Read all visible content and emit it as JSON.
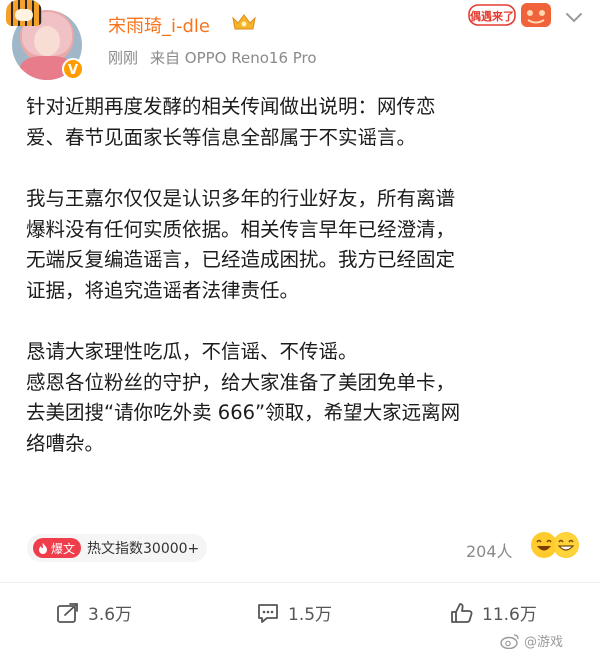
{
  "post": {
    "username": "宋雨琦_i-dle",
    "time": "刚刚",
    "source": "来自 OPPO Reno16 Pro",
    "paragraphs": [
      "针对近期再度发酵的相关传闻做出说明：网传恋\n爱、春节见面家长等信息全部属于不实谣言。",
      "我与王嘉尔仅仅是认识多年的行业好友，所有离谱\n爆料没有任何实质依据。相关传言早年已经澄清，\n无端反复编造谣言，已经造成困扰。我方已经固定\n证据，将追究造谣者法律责任。",
      "恳请大家理性吃瓜，不信谣、不传谣。\n感恩各位粉丝的守护，给大家准备了美团免单卡，\n去美团搜“请你吃外卖 666”领取，希望大家远离网\n络嘈杂。"
    ],
    "tag": {
      "badge": "爆文",
      "text": "热文指数30000+"
    },
    "likers_count": "204人",
    "sticker_text": "偶遇来了",
    "actions": {
      "repost": "3.6万",
      "comment": "1.5万",
      "like": "11.6万"
    },
    "watermark": "@游戏"
  },
  "icons": {
    "verified": "v-badge-icon",
    "crown": "crown-icon",
    "menu": "chevron-down-icon",
    "repost": "repost-icon",
    "comment": "comment-icon",
    "like": "thumbs-up-icon"
  },
  "colors": {
    "username": "#f7741d",
    "verified": "#ff9d00",
    "badge": "#f03d4b",
    "meta": "#8a8a8a"
  }
}
